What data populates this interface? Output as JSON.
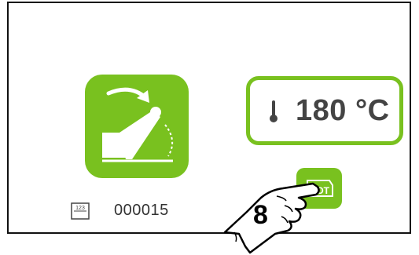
{
  "temperature": {
    "value": "180 °C"
  },
  "counter": {
    "value": "000015",
    "icon": "counter-icon",
    "icon_text": "123"
  },
  "lot_button": {
    "label": "LOT",
    "icon": "lot-icon"
  },
  "lid_button": {
    "icon": "lid-open-icon"
  },
  "callout": {
    "step": "8",
    "icon": "hand-pointer-icon"
  },
  "colors": {
    "accent": "#79c11f",
    "frame": "#111111",
    "text": "#444444"
  }
}
